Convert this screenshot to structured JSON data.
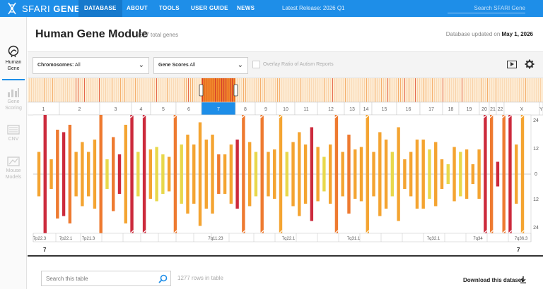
{
  "nav": {
    "logo_sfari": "SFARI",
    "logo_gene": "GENE",
    "items": [
      {
        "label": "DATABASE"
      },
      {
        "label": "ABOUT"
      },
      {
        "label": "TOOLS"
      },
      {
        "label": "USER GUIDE"
      },
      {
        "label": "NEWS"
      }
    ],
    "release": "Latest Release: 2026 Q1",
    "search_placeholder": "Search SFARI Gene",
    "accent_color": "#1e8ee8"
  },
  "sidebar": {
    "items": [
      {
        "label_line1": "Human",
        "label_line2": "Gene",
        "icon": "human-head-icon"
      },
      {
        "label_line1": "Gene",
        "label_line2": "Scoring",
        "icon": "scoring-chart-icon"
      },
      {
        "label_line1": "CNV",
        "label_line2": "",
        "icon": "cnv-icon"
      },
      {
        "label_line1": "Mouse",
        "label_line2": "Models",
        "icon": "mouse-model-icon"
      }
    ]
  },
  "header": {
    "title": "Human Gene Module",
    "total_genes": "1277 total genes",
    "updated_prefix": "Database updated on",
    "updated_date": "May 1, 2026"
  },
  "filters": {
    "chromosomes_label": "Chromosomes:",
    "chromosomes_value": "All",
    "gene_scores_label": "Gene Scores",
    "gene_scores_value": "All",
    "overlay_label": "Overlay Ratio of Autism Reports",
    "overlay_checked": false
  },
  "chart_data": {
    "type": "bar",
    "chromosome_labels": [
      "1",
      "2",
      "3",
      "4",
      "5",
      "6",
      "7",
      "8",
      "9",
      "10",
      "11",
      "12",
      "13",
      "14",
      "15",
      "16",
      "17",
      "18",
      "19",
      "20",
      "21",
      "22",
      "X",
      "Y"
    ],
    "selected_chromosome": "7",
    "y_ticks_right": [
      "24",
      "12",
      "0",
      "12",
      "24"
    ],
    "band_labels": [
      "7p22.3",
      "7p22.1",
      "7p21.3",
      "7q11.23",
      "7q22.1",
      "7q31.1",
      "7q32.1",
      "7q34",
      "7q36.3"
    ],
    "start_label": "7",
    "end_label": "7",
    "colors": {
      "score_high": "#cc2a3c",
      "score_mid": "#ee7a30",
      "score_low": "#f4a431",
      "score_lowest": "#e8d84c"
    },
    "bars": [
      {
        "v": 9,
        "c": 2
      },
      {
        "v": 24,
        "c": 0
      },
      {
        "v": 6,
        "c": 2
      },
      {
        "v": 18,
        "c": 1
      },
      {
        "v": 17,
        "c": 0
      },
      {
        "v": 20,
        "c": 1
      },
      {
        "v": 9,
        "c": 2
      },
      {
        "v": 13,
        "c": 2
      },
      {
        "v": 9,
        "c": 2
      },
      {
        "v": 14,
        "c": 2
      },
      {
        "v": 24,
        "c": 1
      },
      {
        "v": 6,
        "c": 3
      },
      {
        "v": 15,
        "c": 1
      },
      {
        "v": 8,
        "c": 0
      },
      {
        "v": 20,
        "c": 2
      },
      {
        "v": 28,
        "c": 0
      },
      {
        "v": 9,
        "c": 3
      },
      {
        "v": 27,
        "c": 0
      },
      {
        "v": 10,
        "c": 2
      },
      {
        "v": 11,
        "c": 3
      },
      {
        "v": 8,
        "c": 3
      },
      {
        "v": 7,
        "c": 2
      },
      {
        "v": 33,
        "c": 1
      },
      {
        "v": 12,
        "c": 3
      },
      {
        "v": 16,
        "c": 2
      },
      {
        "v": 12,
        "c": 2
      },
      {
        "v": 21,
        "c": 2
      },
      {
        "v": 14,
        "c": 2
      },
      {
        "v": 16,
        "c": 2
      },
      {
        "v": 8,
        "c": 1
      },
      {
        "v": 8,
        "c": 2
      },
      {
        "v": 12,
        "c": 2
      },
      {
        "v": 14,
        "c": 0
      },
      {
        "v": 25,
        "c": 1
      },
      {
        "v": 13,
        "c": 2
      },
      {
        "v": 9,
        "c": 3
      },
      {
        "v": 33,
        "c": 1
      },
      {
        "v": 9,
        "c": 2
      },
      {
        "v": 10,
        "c": 2
      },
      {
        "v": 26,
        "c": 2
      },
      {
        "v": 9,
        "c": 3
      },
      {
        "v": 13,
        "c": 2
      },
      {
        "v": 17,
        "c": 2
      },
      {
        "v": 12,
        "c": 2
      },
      {
        "v": 19,
        "c": 0
      },
      {
        "v": 11,
        "c": 2
      },
      {
        "v": 7,
        "c": 3
      },
      {
        "v": 12,
        "c": 2
      },
      {
        "v": 33,
        "c": 1
      },
      {
        "v": 9,
        "c": 2
      },
      {
        "v": 16,
        "c": 1
      },
      {
        "v": 10,
        "c": 2
      },
      {
        "v": 11,
        "c": 2
      },
      {
        "v": 33,
        "c": 2
      },
      {
        "v": 9,
        "c": 2
      },
      {
        "v": 17,
        "c": 2
      },
      {
        "v": 14,
        "c": 2
      },
      {
        "v": 9,
        "c": 3
      },
      {
        "v": 19,
        "c": 2
      },
      {
        "v": 6,
        "c": 2
      },
      {
        "v": 9,
        "c": 2
      },
      {
        "v": 14,
        "c": 2
      },
      {
        "v": 14,
        "c": 2
      },
      {
        "v": 10,
        "c": 3
      },
      {
        "v": 13,
        "c": 2
      },
      {
        "v": 6,
        "c": 2
      },
      {
        "v": 4,
        "c": 3
      },
      {
        "v": 11,
        "c": 2
      },
      {
        "v": 9,
        "c": 3
      },
      {
        "v": 10,
        "c": 2
      },
      {
        "v": 4,
        "c": 2
      },
      {
        "v": 10,
        "c": 2
      },
      {
        "v": 33,
        "c": 0
      },
      {
        "v": 33,
        "c": 1
      },
      {
        "v": 5,
        "c": 0
      },
      {
        "v": 33,
        "c": 1
      },
      {
        "v": 33,
        "c": 0
      },
      {
        "v": 12,
        "c": 2
      },
      {
        "v": 33,
        "c": 2
      }
    ]
  },
  "table": {
    "search_placeholder": "Search this table",
    "rows_count": "1277 rows in table",
    "download_label": "Download this dataset"
  }
}
